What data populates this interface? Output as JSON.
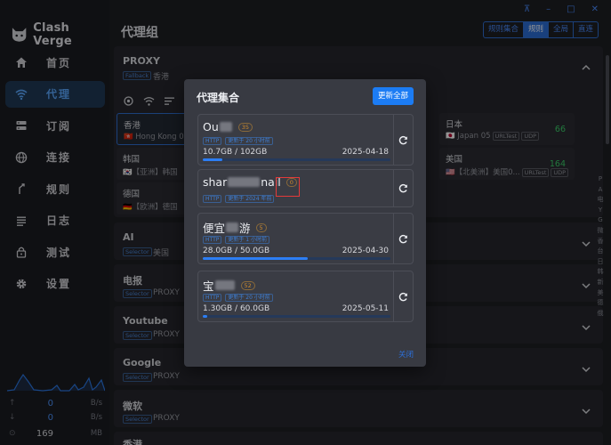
{
  "app": {
    "title": "Clash Verge"
  },
  "window": {
    "controls": [
      "⊼",
      "–",
      "□",
      "✕"
    ]
  },
  "page": {
    "title": "代理组"
  },
  "modes": [
    {
      "label": "规则集合",
      "active": false
    },
    {
      "label": "规则",
      "active": true
    },
    {
      "label": "全局",
      "active": false
    },
    {
      "label": "直连",
      "active": false
    }
  ],
  "nav": [
    {
      "label": "首页",
      "icon": "home-icon",
      "active": false
    },
    {
      "label": "代理",
      "icon": "wifi-icon",
      "active": true
    },
    {
      "label": "订阅",
      "icon": "subscription-icon",
      "active": false
    },
    {
      "label": "连接",
      "icon": "globe-icon",
      "active": false
    },
    {
      "label": "规则",
      "icon": "route-icon",
      "active": false
    },
    {
      "label": "日志",
      "icon": "list-icon",
      "active": false
    },
    {
      "label": "测试",
      "icon": "lock-icon",
      "active": false
    },
    {
      "label": "设置",
      "icon": "gear-icon",
      "active": false
    }
  ],
  "stats": {
    "upload": {
      "arrow": "↑",
      "value": "0",
      "unit": "B/s"
    },
    "download": {
      "arrow": "↓",
      "value": "0",
      "unit": "B/s"
    },
    "memory": {
      "value": "169",
      "unit": "MB"
    }
  },
  "groups": [
    {
      "name": "PROXY",
      "type": "Fallback",
      "now": "香港"
    },
    {
      "name": "AI",
      "type": "Selector",
      "now": "美国"
    },
    {
      "name": "电报",
      "type": "Selector",
      "now": "PROXY"
    },
    {
      "name": "Youtube",
      "type": "Selector",
      "now": "PROXY"
    },
    {
      "name": "Google",
      "type": "Selector",
      "now": "PROXY"
    },
    {
      "name": "微软",
      "type": "Selector",
      "now": "PROXY"
    },
    {
      "name": "香港",
      "type": "",
      "now": ""
    }
  ],
  "proxy_cards": [
    {
      "name": "香港",
      "sub": "🇭🇰 Hong Kong 0",
      "delay": ""
    },
    {
      "name": "韩国",
      "sub": "🇰🇷【亚洲】韩国",
      "delay": ""
    },
    {
      "name": "德国",
      "sub": "🇩🇪【欧洲】德国",
      "delay": ""
    },
    {
      "name": "日本",
      "sub": "🇯🇵 Japan 05",
      "tags": [
        "URLTest",
        "UDP"
      ],
      "delay": "66"
    },
    {
      "name": "美国",
      "sub": "🇺🇸【北美洲】美国0...",
      "tags": [
        "URLTest",
        "UDP"
      ],
      "delay": "164"
    }
  ],
  "alpha_index": [
    "P",
    "A",
    "电",
    "Y",
    "G",
    "微",
    "香",
    "台",
    "日",
    "韩",
    "新",
    "美",
    "德",
    "俄"
  ],
  "modal": {
    "title": "代理集合",
    "update_all": "更新全部",
    "close": "关闭",
    "providers": [
      {
        "name_visible": "Ou",
        "count": "35",
        "meta": [
          "HTTP",
          "更新于 20 小时前"
        ],
        "traffic": "10.7GB / 102GB",
        "date": "2025-04-18",
        "usage": 0.105
      },
      {
        "name_visible": "shar",
        "name_suffix": "nail",
        "count": "0",
        "meta": [
          "HTTP",
          "更新于 2024 年前"
        ],
        "traffic": "",
        "date": "",
        "usage": null
      },
      {
        "name_visible": "便宜",
        "name_suffix": "游",
        "count": "5",
        "meta": [
          "HTTP",
          "更新于 1 小时前"
        ],
        "traffic": "28.0GB / 50.0GB",
        "date": "2025-04-30",
        "usage": 0.56
      },
      {
        "name_visible": "宝",
        "count": "52",
        "meta": [
          "HTTP",
          "更新于 20 小时前"
        ],
        "traffic": "1.30GB / 60.0GB",
        "date": "2025-05-11",
        "usage": 0.022
      }
    ]
  },
  "colors": {
    "accent": "#2c7ef4",
    "delay_ok": "#3ccf6a",
    "highlight": "#e33a3a"
  }
}
